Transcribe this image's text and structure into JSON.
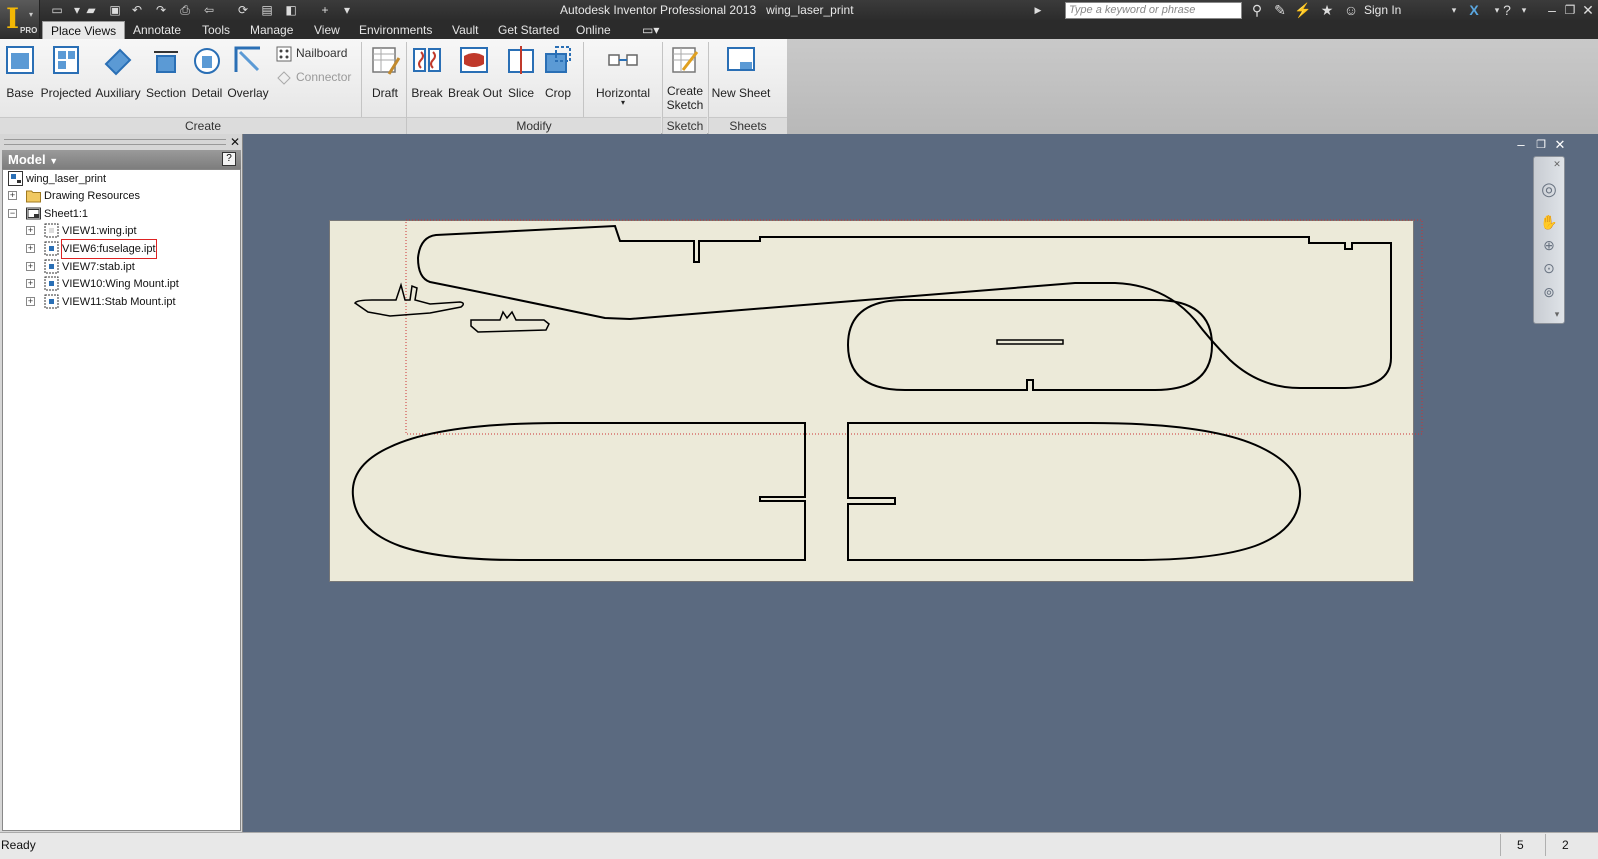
{
  "titlebar": {
    "app_title": "Autodesk Inventor Professional 2013",
    "document": "wing_laser_print",
    "search_placeholder": "Type a keyword or phrase",
    "sign_in": "Sign In",
    "logo_badge": "PRO"
  },
  "tabs": [
    "Place Views",
    "Annotate",
    "Tools",
    "Manage",
    "View",
    "Environments",
    "Vault",
    "Get Started",
    "Online"
  ],
  "active_tab": "Place Views",
  "ribbon": {
    "create": {
      "label": "Create",
      "buttons": [
        "Base",
        "Projected",
        "Auxiliary",
        "Section",
        "Detail",
        "Overlay"
      ],
      "small_buttons": [
        "Nailboard",
        "Connector"
      ]
    },
    "draft": {
      "label": "Draft"
    },
    "modify": {
      "label": "Modify",
      "buttons": [
        "Break",
        "Break Out",
        "Slice",
        "Crop"
      ]
    },
    "horizontal": {
      "label": "Horizontal"
    },
    "sketch": {
      "label": "Sketch",
      "button_line1": "Create",
      "button_line2": "Sketch"
    },
    "sheets": {
      "label": "Sheets",
      "button": "New Sheet"
    }
  },
  "browser": {
    "header": "Model",
    "help": "?",
    "tree": [
      {
        "label": "wing_laser_print",
        "level": 0,
        "icon": "drawing-icon",
        "expander": ""
      },
      {
        "label": "Drawing Resources",
        "level": 0,
        "icon": "folder-icon",
        "expander": "+"
      },
      {
        "label": "Sheet1:1",
        "level": 0,
        "icon": "sheet-icon",
        "expander": "−"
      },
      {
        "label": "VIEW1:wing.ipt",
        "level": 1,
        "icon": "view-icon",
        "expander": "+"
      },
      {
        "label": "VIEW6:fuselage.ipt",
        "level": 1,
        "icon": "view-icon",
        "expander": "+",
        "selected": true
      },
      {
        "label": "VIEW7:stab.ipt",
        "level": 1,
        "icon": "view-icon",
        "expander": "+"
      },
      {
        "label": "VIEW10:Wing Mount.ipt",
        "level": 1,
        "icon": "view-icon",
        "expander": "+"
      },
      {
        "label": "VIEW11:Stab Mount.ipt",
        "level": 1,
        "icon": "view-icon",
        "expander": "+"
      }
    ]
  },
  "status": {
    "text": "Ready",
    "num1": "5",
    "num2": "2"
  },
  "colors": {
    "sheet": "#ecead9",
    "viewport": "#5b6a80",
    "outline": "#000000",
    "view_boundary": "#cc3333"
  }
}
